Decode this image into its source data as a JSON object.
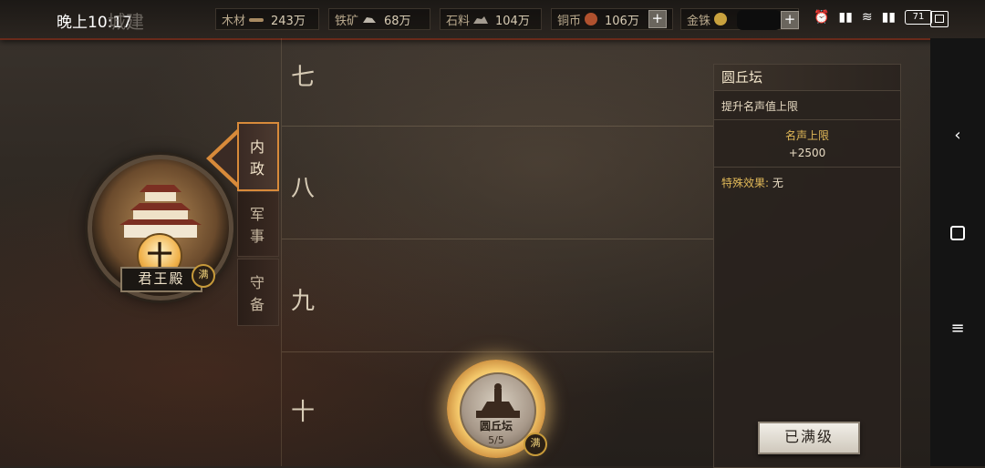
{
  "statusbar": {
    "time": "晚上10:17",
    "battery": "71"
  },
  "screen_title": "城建",
  "resources": [
    {
      "label": "木材",
      "value": "243万",
      "icon": "wood-icon"
    },
    {
      "label": "铁矿",
      "value": "68万",
      "icon": "ore-icon"
    },
    {
      "label": "石料",
      "value": "104万",
      "icon": "stone-icon"
    },
    {
      "label": "铜币",
      "value": "106万",
      "icon": "copper-coin-icon"
    },
    {
      "label": "金铢",
      "value": "",
      "icon": "gold-coin-icon"
    }
  ],
  "palace": {
    "name": "君王殿",
    "rank": "十",
    "badge": "满"
  },
  "tabs": [
    {
      "label": "内\n政",
      "active": true
    },
    {
      "label": "军\n事",
      "active": false
    },
    {
      "label": "守\n备",
      "active": false
    }
  ],
  "tiers": [
    "七",
    "八",
    "九",
    "十"
  ],
  "building": {
    "name": "圆丘坛",
    "count": "5/5",
    "badge": "满"
  },
  "panel": {
    "title": "圆丘坛",
    "description": "提升名声值上限",
    "stat_label": "名声上限",
    "stat_value": "+2500",
    "special_label": "特殊效果:",
    "special_value": "无",
    "button_label": "已满级"
  },
  "colors": {
    "accent": "#d88a3a",
    "gold": "#e0b858",
    "panel_bg": "#28221d"
  }
}
